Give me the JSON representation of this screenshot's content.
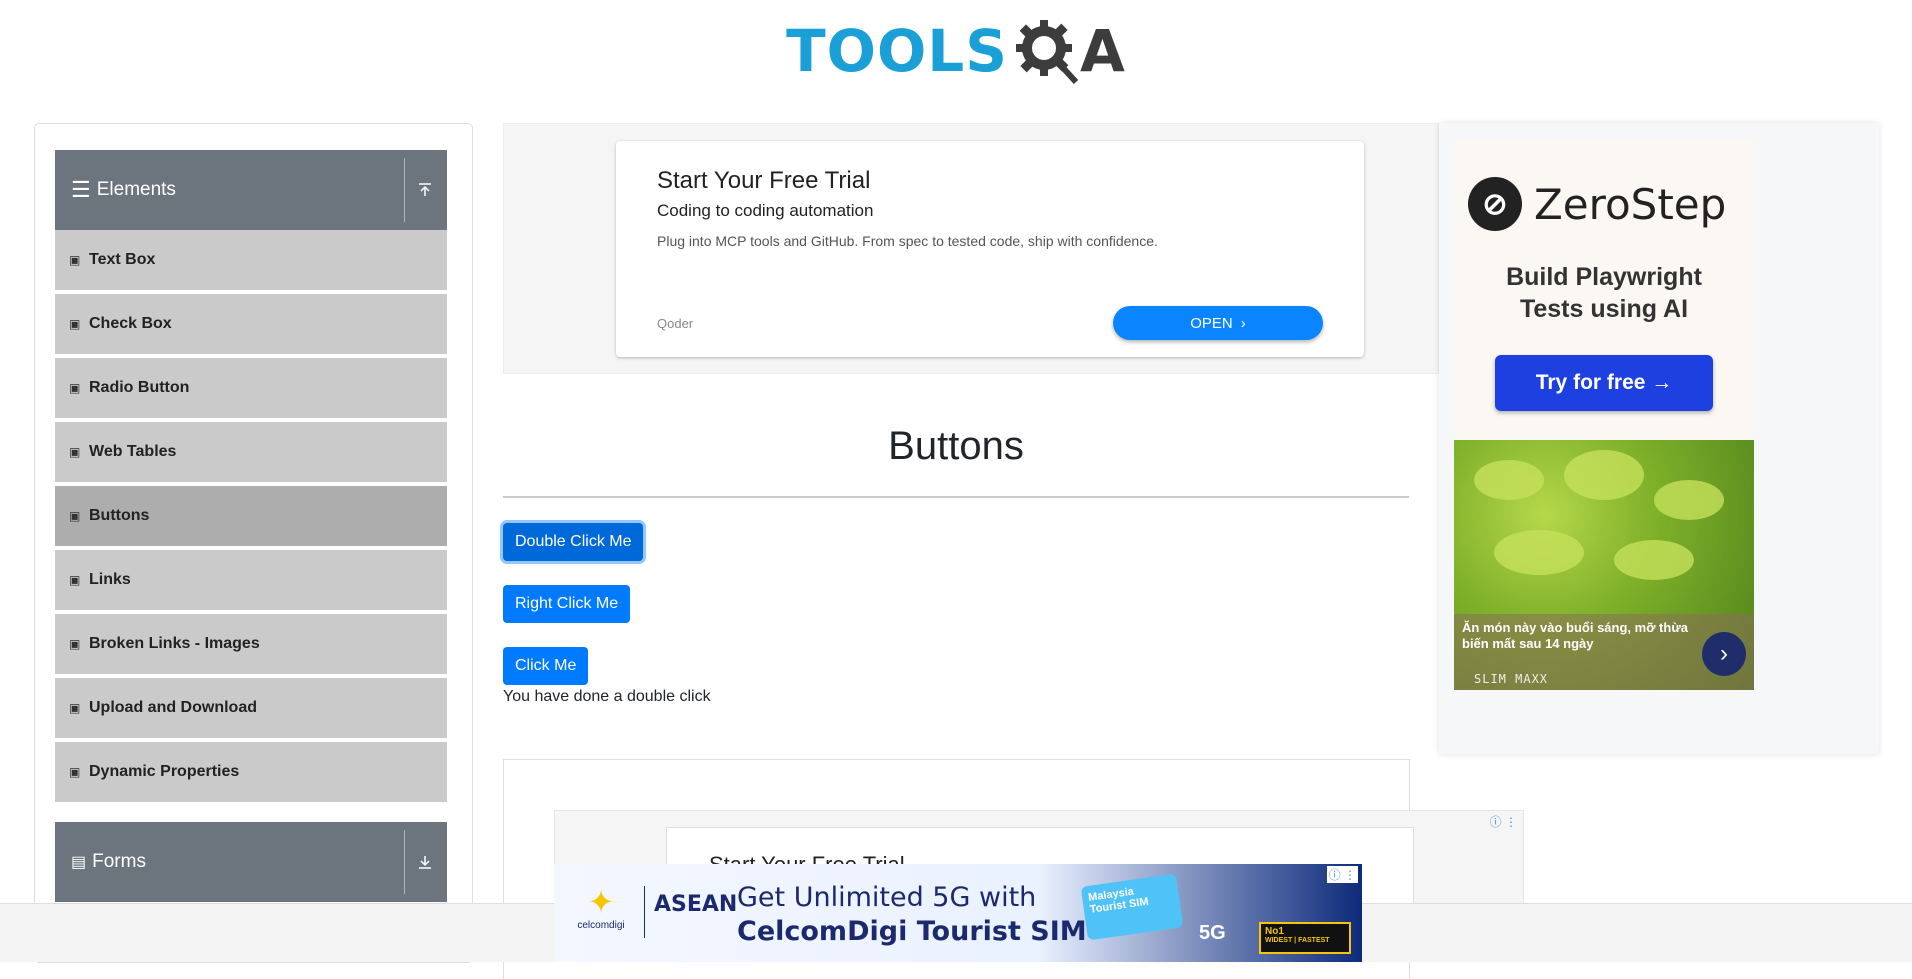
{
  "logo": {
    "part1": "TOOLS",
    "part2": "A"
  },
  "sidebar": {
    "group_elements": {
      "label": "Elements",
      "icon": "hamburger-icon",
      "toggle_icon": "collapse-up-icon"
    },
    "items": [
      {
        "label": "Text Box"
      },
      {
        "label": "Check Box"
      },
      {
        "label": "Radio Button"
      },
      {
        "label": "Web Tables"
      },
      {
        "label": "Buttons"
      },
      {
        "label": "Links"
      },
      {
        "label": "Broken Links - Images"
      },
      {
        "label": "Upload and Download"
      },
      {
        "label": "Dynamic Properties"
      }
    ],
    "active_item": "Buttons",
    "group_forms": {
      "label": "Forms",
      "icon": "document-icon",
      "toggle_icon": "expand-down-icon"
    }
  },
  "ad_top": {
    "title": "Start Your Free Trial",
    "subtitle": "Coding to coding automation",
    "description": "Plug into MCP tools and GitHub. From spec to tested code, ship with confidence.",
    "brand": "Qoder",
    "button": "OPEN"
  },
  "main": {
    "title": "Buttons",
    "double_click_btn": "Double Click Me",
    "right_click_btn": "Right Click Me",
    "click_btn": "Click Me",
    "message": "You have done a double click"
  },
  "ad_bottom": {
    "title": "Start Your Free Trial"
  },
  "banner": {
    "brand": "celcomdigi",
    "asean": "ASEAN",
    "line1": "Get Unlimited 5G with",
    "line2": "CelcomDigi Tourist SIM",
    "sim_label": "Malaysia Tourist SIM",
    "network": "5G",
    "badge": "No1",
    "badge_sub": "WIDEST | FASTEST"
  },
  "ad_right": {
    "brand": "ZeroStep",
    "tagline1": "Build Playwright",
    "tagline2": "Tests using AI",
    "button": "Try for free →",
    "promo_text": "Ăn món này vào buổi sáng, mỡ thừa biến mất sau 14 ngày",
    "promo_brand": "SLIM MAXX"
  },
  "colors": {
    "primary": "#007bff",
    "sidebar_header": "#6c757d",
    "menu_item": "#cacaca",
    "menu_active": "#adadad"
  }
}
